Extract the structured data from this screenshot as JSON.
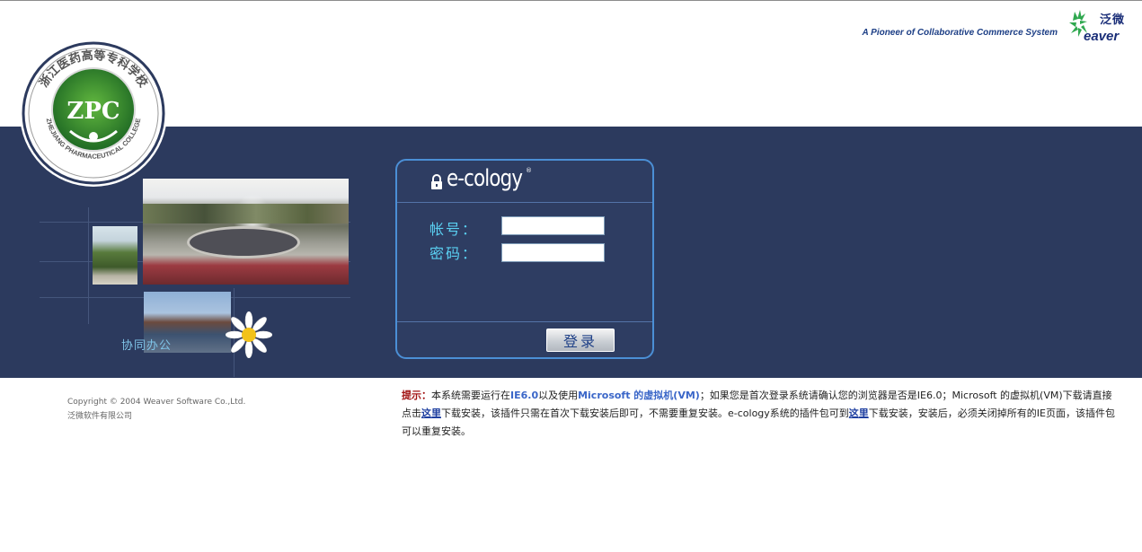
{
  "header": {
    "tagline": "A Pioneer of Collaborative Commerce System",
    "brand_cn": "泛微",
    "brand_en": "eaver"
  },
  "school": {
    "name_cn": "浙江医药高等专科学校",
    "name_en": "ZHEJIANG PHARMACEUTICAL COLLEGE",
    "abbr": "ZPC"
  },
  "decor": {
    "caption": "协同办公"
  },
  "login": {
    "product": "e-cology",
    "reg_mark": "®",
    "account_label": "帐号：",
    "password_label": "密码：",
    "account_value": "",
    "password_value": "",
    "submit_label": "登录"
  },
  "footer": {
    "copyright_en": "Copyright © 2004 Weaver Software Co.,Ltd.",
    "copyright_cn": "泛微软件有限公司"
  },
  "notice": {
    "prefix": "提示：",
    "t1": "本系统需要运行在",
    "ie": "IE6.0",
    "t2": "以及使用",
    "vm": "Microsoft 的虚拟机(VM)",
    "t3": "；如果您是首次登录系统请确认您的浏览器是否是IE6.0；Microsoft 的虚拟机(VM)下载请直接点击",
    "link1": "这里",
    "t4": "下载安装，该插件只需在首次下载安装后即可，不需要重复安装。e-cology系统的插件包可到",
    "link2": "这里",
    "t5": "下载安装，安装后，必须关闭掉所有的IE页面，该插件包可以重复安装。"
  },
  "colors": {
    "band": "#2c3a5e",
    "login_border": "#4b8fd6",
    "label": "#5ad0f2",
    "brand": "#1a2e78",
    "hint": "#a01010"
  }
}
